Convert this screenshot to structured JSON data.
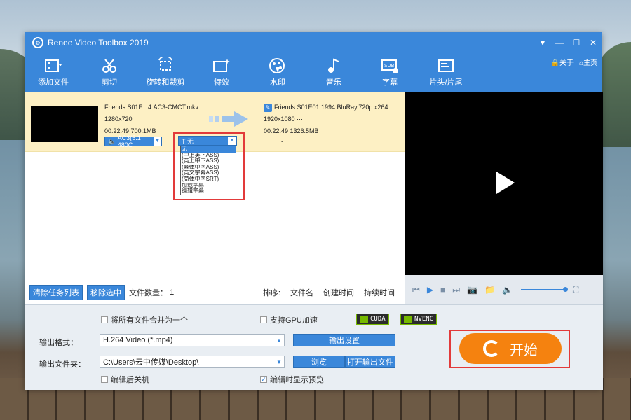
{
  "window": {
    "title": "Renee Video Toolbox 2019",
    "controls": [
      "▾",
      "—",
      "☐",
      "✕"
    ]
  },
  "toolbar": {
    "items": [
      {
        "label": "添加文件",
        "icon": "add-file-icon"
      },
      {
        "label": "剪切",
        "icon": "scissors-icon"
      },
      {
        "label": "旋转和裁剪",
        "icon": "rotate-crop-icon"
      },
      {
        "label": "特效",
        "icon": "effects-icon"
      },
      {
        "label": "水印",
        "icon": "watermark-icon"
      },
      {
        "label": "音乐",
        "icon": "music-icon"
      },
      {
        "label": "字幕",
        "icon": "subtitle-icon"
      },
      {
        "label": "片头/片尾",
        "icon": "intro-outro-icon"
      }
    ],
    "about": "关于",
    "home": "主页"
  },
  "file": {
    "src": {
      "name": "Friends.S01E...4.AC3-CMCT.mkv",
      "res": "1280x720",
      "time_size": "00:22:49  700.1MB"
    },
    "dst": {
      "name": "Friends.S01E01.1994.BluRay.720p.x264..",
      "res": "1920x1080  ···",
      "time_size": "00:22:49  1326.5MB"
    },
    "audio": "AC3(5.1 480C",
    "audio_dst": "-",
    "subtitle": {
      "selected": "T  无",
      "options": [
        "无",
        "(中上英下ASS)",
        "(英上中下ASS)",
        "(繁体中字ASS)",
        "(英文字幕ASS)",
        "(简体中字SRT)",
        "加载字幕",
        "编辑字幕"
      ]
    }
  },
  "list_actions": {
    "clear": "清除任务列表",
    "remove": "移除选中",
    "count_label": "文件数量：",
    "count": "1",
    "sort_label": "排序:",
    "sort_name": "文件名",
    "sort_created": "创建时间",
    "sort_duration": "持续时间"
  },
  "options": {
    "merge": "将所有文件合并为一个",
    "gpu": "支持GPU加速",
    "cuda": "CUDA",
    "nvenc": "NVENC",
    "shutdown": "编辑后关机",
    "preview": "编辑时显示预览"
  },
  "output": {
    "format_label": "输出格式：",
    "format_value": "H.264 Video (*.mp4)",
    "settings_btn": "输出设置",
    "folder_label": "输出文件夹：",
    "folder_value": "C:\\Users\\云中传媒\\Desktop\\",
    "browse_btn": "浏览",
    "open_btn": "打开输出文件"
  },
  "start": "开始",
  "colors": {
    "accent": "#3a87da",
    "start": "#f5820f",
    "highlight": "#e23a3a"
  }
}
